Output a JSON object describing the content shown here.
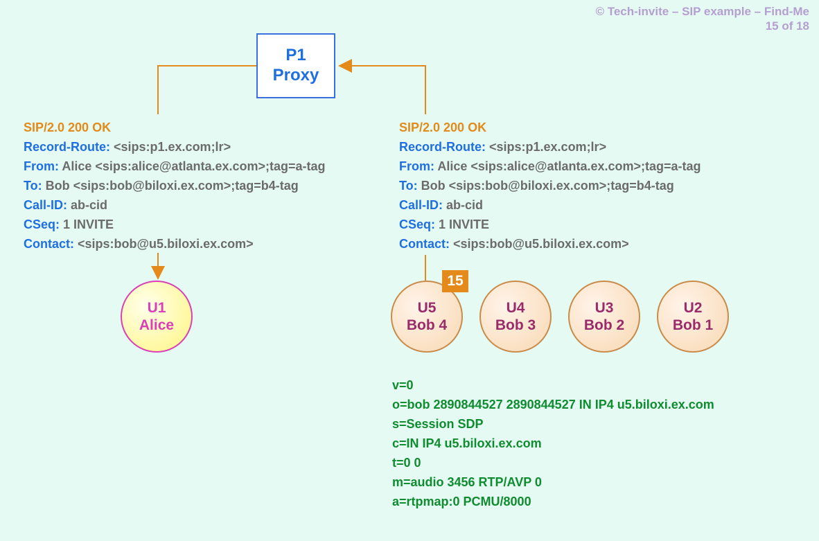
{
  "attribution": {
    "line1": "© Tech-invite – SIP example – Find-Me",
    "line2": "15 of 18"
  },
  "proxy": {
    "line1": "P1",
    "line2": "Proxy"
  },
  "left_headers": {
    "status": "SIP/2.0 200 OK",
    "record_route_label": "Record-Route:",
    "record_route_value": " <sips:p1.ex.com;lr>",
    "from_label": "From:",
    "from_value": " Alice <sips:alice@atlanta.ex.com>;tag=a-tag",
    "to_label": "To:",
    "to_value": " Bob <sips:bob@biloxi.ex.com>;tag=b4-tag",
    "callid_label": "Call-ID:",
    "callid_value": " ab-cid",
    "cseq_label": "CSeq:",
    "cseq_value": " 1 INVITE",
    "contact_label": "Contact:",
    "contact_value": " <sips:bob@u5.biloxi.ex.com>"
  },
  "right_headers": {
    "status": "SIP/2.0 200 OK",
    "record_route_label": "Record-Route:",
    "record_route_value": " <sips:p1.ex.com;lr>",
    "from_label": "From:",
    "from_value": " Alice <sips:alice@atlanta.ex.com>;tag=a-tag",
    "to_label": "To:",
    "to_value": " Bob <sips:bob@biloxi.ex.com>;tag=b4-tag",
    "callid_label": "Call-ID:",
    "callid_value": " ab-cid",
    "cseq_label": "CSeq:",
    "cseq_value": " 1 INVITE",
    "contact_label": "Contact:",
    "contact_value": " <sips:bob@u5.biloxi.ex.com>"
  },
  "alice": {
    "line1": "U1",
    "line2": "Alice"
  },
  "u5": {
    "line1": "U5",
    "line2": "Bob 4"
  },
  "u4": {
    "line1": "U4",
    "line2": "Bob 3"
  },
  "u3": {
    "line1": "U3",
    "line2": "Bob 2"
  },
  "u2": {
    "line1": "U2",
    "line2": "Bob 1"
  },
  "step_badge": "15",
  "sdp": {
    "l1": "v=0",
    "l2": "o=bob  2890844527  2890844527  IN  IP4  u5.biloxi.ex.com",
    "l3": "s=Session SDP",
    "l4": "c=IN  IP4  u5.biloxi.ex.com",
    "l5": "t=0  0",
    "l6": "m=audio  3456  RTP/AVP  0",
    "l7": "a=rtpmap:0  PCMU/8000"
  }
}
